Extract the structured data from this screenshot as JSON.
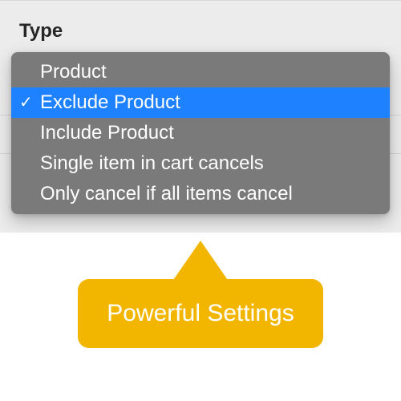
{
  "field": {
    "label": "Type"
  },
  "dropdown": {
    "selected_index": 1,
    "items": [
      {
        "label": "Product"
      },
      {
        "label": "Exclude Product"
      },
      {
        "label": "Include Product"
      },
      {
        "label": "Single item in cart cancels"
      },
      {
        "label": "Only cancel if all items cancel"
      }
    ]
  },
  "callout": {
    "text": "Powerful Settings"
  },
  "colors": {
    "highlight": "#1e81ff",
    "menu_bg": "#7a7a7a",
    "panel_bg": "#ececec",
    "callout_bg": "#f3b600"
  }
}
